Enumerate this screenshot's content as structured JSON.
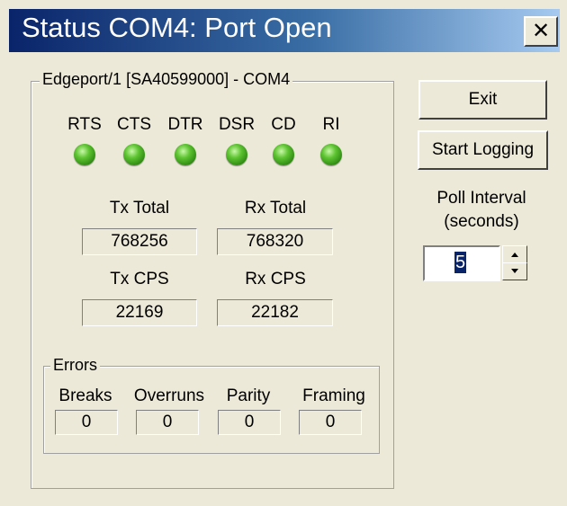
{
  "window": {
    "title": "Status COM4: Port Open",
    "close_glyph": "✕"
  },
  "port_group": {
    "legend": "Edgeport/1 [SA40599000] - COM4",
    "signals": [
      {
        "label": "RTS",
        "state": "on",
        "color": "#3fae1e"
      },
      {
        "label": "CTS",
        "state": "on",
        "color": "#3fae1e"
      },
      {
        "label": "DTR",
        "state": "on",
        "color": "#3fae1e"
      },
      {
        "label": "DSR",
        "state": "on",
        "color": "#3fae1e"
      },
      {
        "label": "CD",
        "state": "on",
        "color": "#3fae1e"
      },
      {
        "label": "RI",
        "state": "on",
        "color": "#3fae1e"
      }
    ],
    "tx_total": {
      "label": "Tx Total",
      "value": "768256"
    },
    "rx_total": {
      "label": "Rx Total",
      "value": "768320"
    },
    "tx_cps": {
      "label": "Tx CPS",
      "value": "22169"
    },
    "rx_cps": {
      "label": "Rx CPS",
      "value": "22182"
    },
    "errors": {
      "legend": "Errors",
      "items": [
        {
          "label": "Breaks",
          "value": "0"
        },
        {
          "label": "Overruns",
          "value": "0"
        },
        {
          "label": "Parity",
          "value": "0"
        },
        {
          "label": "Framing",
          "value": "0"
        }
      ]
    }
  },
  "buttons": {
    "exit": "Exit",
    "start_logging": "Start Logging"
  },
  "poll": {
    "label_line1": "Poll Interval",
    "label_line2": "(seconds)",
    "value": "5"
  }
}
